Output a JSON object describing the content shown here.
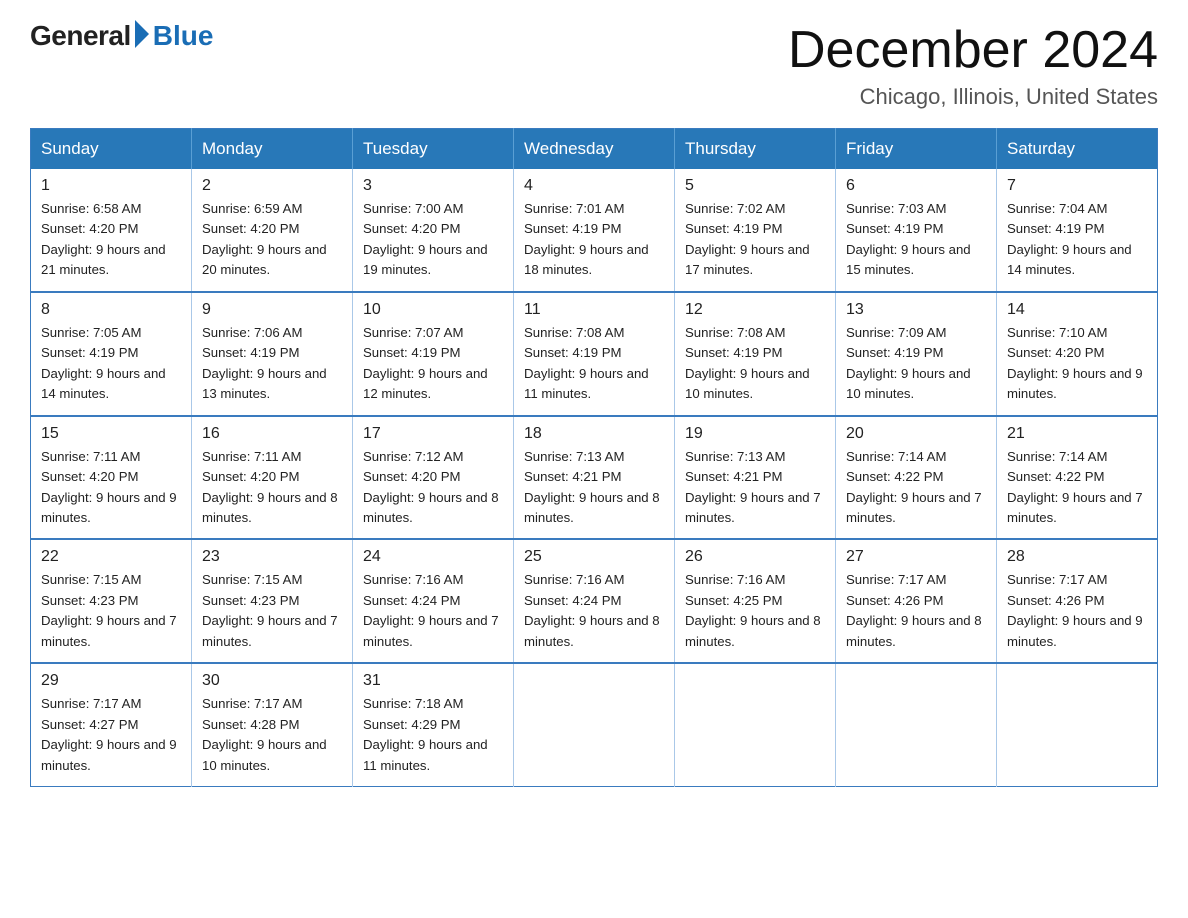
{
  "logo": {
    "general": "General",
    "blue": "Blue"
  },
  "title": "December 2024",
  "subtitle": "Chicago, Illinois, United States",
  "days_of_week": [
    "Sunday",
    "Monday",
    "Tuesday",
    "Wednesday",
    "Thursday",
    "Friday",
    "Saturday"
  ],
  "weeks": [
    [
      {
        "day": "1",
        "sunrise": "6:58 AM",
        "sunset": "4:20 PM",
        "daylight": "9 hours and 21 minutes."
      },
      {
        "day": "2",
        "sunrise": "6:59 AM",
        "sunset": "4:20 PM",
        "daylight": "9 hours and 20 minutes."
      },
      {
        "day": "3",
        "sunrise": "7:00 AM",
        "sunset": "4:20 PM",
        "daylight": "9 hours and 19 minutes."
      },
      {
        "day": "4",
        "sunrise": "7:01 AM",
        "sunset": "4:19 PM",
        "daylight": "9 hours and 18 minutes."
      },
      {
        "day": "5",
        "sunrise": "7:02 AM",
        "sunset": "4:19 PM",
        "daylight": "9 hours and 17 minutes."
      },
      {
        "day": "6",
        "sunrise": "7:03 AM",
        "sunset": "4:19 PM",
        "daylight": "9 hours and 15 minutes."
      },
      {
        "day": "7",
        "sunrise": "7:04 AM",
        "sunset": "4:19 PM",
        "daylight": "9 hours and 14 minutes."
      }
    ],
    [
      {
        "day": "8",
        "sunrise": "7:05 AM",
        "sunset": "4:19 PM",
        "daylight": "9 hours and 14 minutes."
      },
      {
        "day": "9",
        "sunrise": "7:06 AM",
        "sunset": "4:19 PM",
        "daylight": "9 hours and 13 minutes."
      },
      {
        "day": "10",
        "sunrise": "7:07 AM",
        "sunset": "4:19 PM",
        "daylight": "9 hours and 12 minutes."
      },
      {
        "day": "11",
        "sunrise": "7:08 AM",
        "sunset": "4:19 PM",
        "daylight": "9 hours and 11 minutes."
      },
      {
        "day": "12",
        "sunrise": "7:08 AM",
        "sunset": "4:19 PM",
        "daylight": "9 hours and 10 minutes."
      },
      {
        "day": "13",
        "sunrise": "7:09 AM",
        "sunset": "4:19 PM",
        "daylight": "9 hours and 10 minutes."
      },
      {
        "day": "14",
        "sunrise": "7:10 AM",
        "sunset": "4:20 PM",
        "daylight": "9 hours and 9 minutes."
      }
    ],
    [
      {
        "day": "15",
        "sunrise": "7:11 AM",
        "sunset": "4:20 PM",
        "daylight": "9 hours and 9 minutes."
      },
      {
        "day": "16",
        "sunrise": "7:11 AM",
        "sunset": "4:20 PM",
        "daylight": "9 hours and 8 minutes."
      },
      {
        "day": "17",
        "sunrise": "7:12 AM",
        "sunset": "4:20 PM",
        "daylight": "9 hours and 8 minutes."
      },
      {
        "day": "18",
        "sunrise": "7:13 AM",
        "sunset": "4:21 PM",
        "daylight": "9 hours and 8 minutes."
      },
      {
        "day": "19",
        "sunrise": "7:13 AM",
        "sunset": "4:21 PM",
        "daylight": "9 hours and 7 minutes."
      },
      {
        "day": "20",
        "sunrise": "7:14 AM",
        "sunset": "4:22 PM",
        "daylight": "9 hours and 7 minutes."
      },
      {
        "day": "21",
        "sunrise": "7:14 AM",
        "sunset": "4:22 PM",
        "daylight": "9 hours and 7 minutes."
      }
    ],
    [
      {
        "day": "22",
        "sunrise": "7:15 AM",
        "sunset": "4:23 PM",
        "daylight": "9 hours and 7 minutes."
      },
      {
        "day": "23",
        "sunrise": "7:15 AM",
        "sunset": "4:23 PM",
        "daylight": "9 hours and 7 minutes."
      },
      {
        "day": "24",
        "sunrise": "7:16 AM",
        "sunset": "4:24 PM",
        "daylight": "9 hours and 7 minutes."
      },
      {
        "day": "25",
        "sunrise": "7:16 AM",
        "sunset": "4:24 PM",
        "daylight": "9 hours and 8 minutes."
      },
      {
        "day": "26",
        "sunrise": "7:16 AM",
        "sunset": "4:25 PM",
        "daylight": "9 hours and 8 minutes."
      },
      {
        "day": "27",
        "sunrise": "7:17 AM",
        "sunset": "4:26 PM",
        "daylight": "9 hours and 8 minutes."
      },
      {
        "day": "28",
        "sunrise": "7:17 AM",
        "sunset": "4:26 PM",
        "daylight": "9 hours and 9 minutes."
      }
    ],
    [
      {
        "day": "29",
        "sunrise": "7:17 AM",
        "sunset": "4:27 PM",
        "daylight": "9 hours and 9 minutes."
      },
      {
        "day": "30",
        "sunrise": "7:17 AM",
        "sunset": "4:28 PM",
        "daylight": "9 hours and 10 minutes."
      },
      {
        "day": "31",
        "sunrise": "7:18 AM",
        "sunset": "4:29 PM",
        "daylight": "9 hours and 11 minutes."
      },
      null,
      null,
      null,
      null
    ]
  ]
}
